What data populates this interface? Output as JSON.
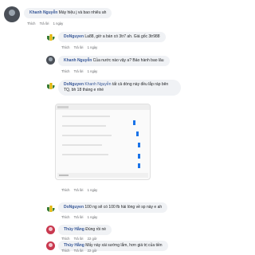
{
  "comments": [
    {
      "author": "Khanh Nguyễn",
      "text": "Máy hiệu j và bao nhiêu ah",
      "actions": {
        "like": "Thích",
        "reply": "Trả lời",
        "time": "1 ngày"
      }
    },
    {
      "author": "DoNguyen",
      "text": "La88, giờ a bán có 3tr7 ah. Giá gốc 3tr988",
      "actions": {
        "like": "Thích",
        "reply": "Trả lời",
        "time": "1 ngày"
      }
    },
    {
      "author": "Khanh Nguyễn",
      "text": "Của nước nào vậy a? Bảo hành bao lâu",
      "actions": {
        "like": "Thích",
        "reply": "Trả lời",
        "time": "1 ngày"
      }
    },
    {
      "author": "DoNguyen",
      "mention": "Khanh Nguyễn",
      "text": "tất cả dòng này đều lắp ráp bên TQ, bh 18 tháng e nhé",
      "actions": {
        "like": "Thích",
        "reply": "Trả lời",
        "time": "1 ngày"
      }
    },
    {
      "author": "DoNguyen",
      "text": "100 ng sẽ có 100 fb hài lòng về sp này e ah",
      "actions": {
        "like": "Thích",
        "reply": "Trả lời",
        "time": "1 ngày"
      }
    },
    {
      "author": "Thủy Hằng",
      "text": "Đúng rồi nè",
      "actions": {
        "like": "Thích",
        "reply": "Trả lời",
        "time": "22 giờ"
      }
    },
    {
      "author": "Thủy Hằng",
      "text": "Mấy này xài sướng lắm, hơn giá trị của tiền",
      "actions": {
        "like": "Thích",
        "reply": "Trả lời",
        "time": "22 giờ"
      }
    }
  ],
  "colors": {
    "name": "#385898",
    "bubble": "#f0f2f5",
    "meta": "#65676b",
    "logo_green": "#3a7d34",
    "logo_yellow": "#e0b400"
  },
  "icons": {
    "logo": "brand-logo-icon",
    "avatar_photo": "user-photo-icon",
    "avatar_pink": "user-photo-icon"
  }
}
